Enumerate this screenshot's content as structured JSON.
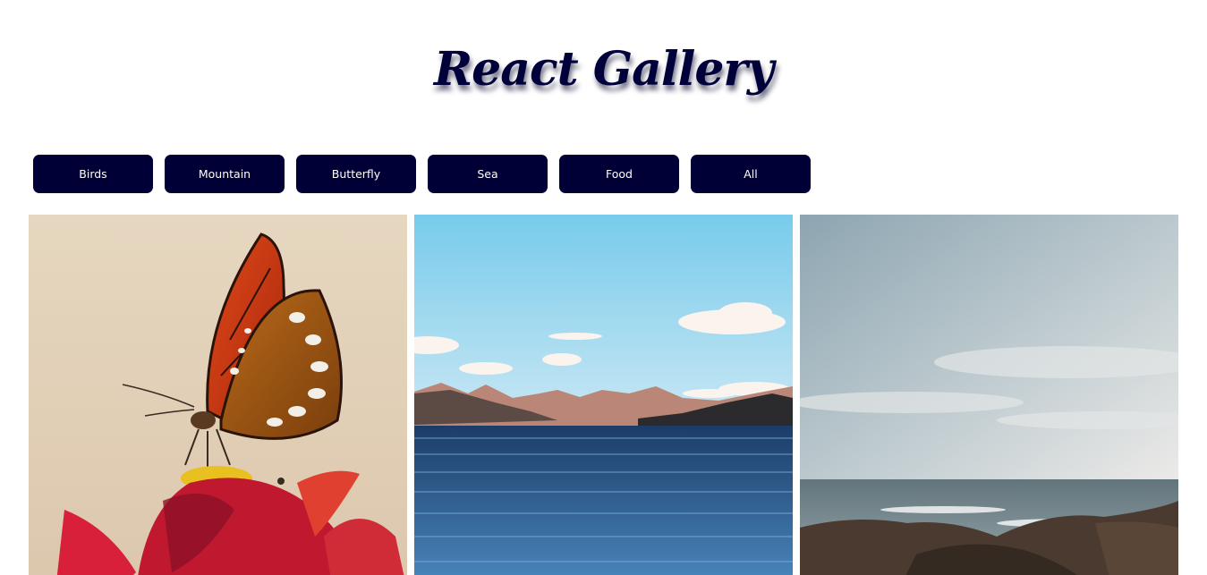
{
  "header": {
    "title": "React Gallery"
  },
  "filters": [
    {
      "label": "Birds"
    },
    {
      "label": "Mountain"
    },
    {
      "label": "Butterfly"
    },
    {
      "label": "Sea"
    },
    {
      "label": "Food"
    },
    {
      "label": "All"
    }
  ],
  "gallery": {
    "items": [
      {
        "subject": "butterfly-on-flower-photo"
      },
      {
        "subject": "mountain-lake-photo"
      },
      {
        "subject": "rocky-sea-shore-photo"
      }
    ]
  },
  "colors": {
    "title": "#00003a",
    "button_bg": "#000036",
    "button_text": "#ffffff",
    "background": "#ffffff"
  }
}
